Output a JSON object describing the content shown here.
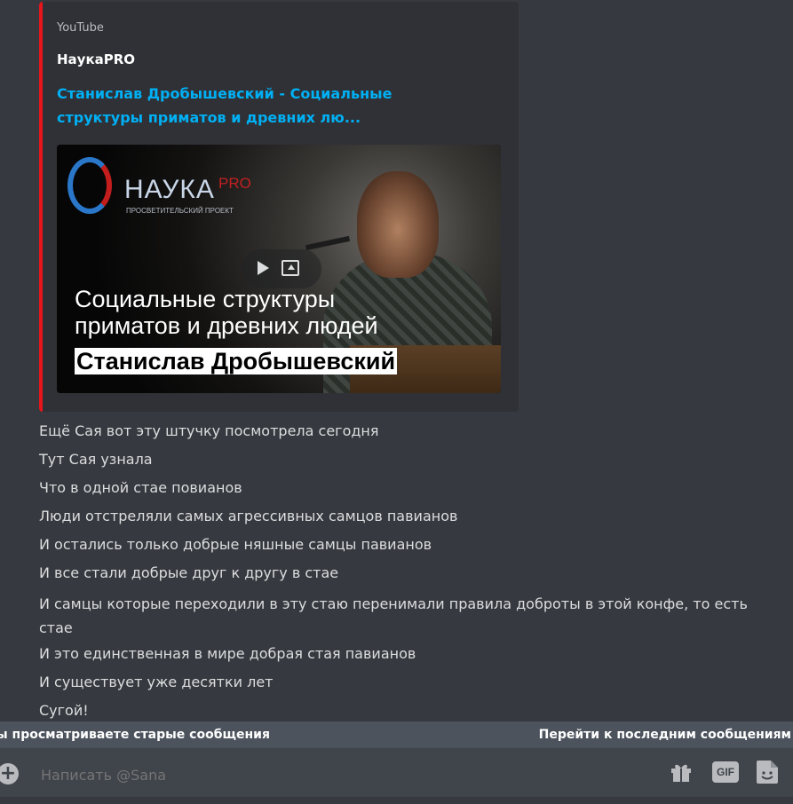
{
  "embed": {
    "provider": "YouTube",
    "author": "НаукаPRO",
    "title": "Станислав Дробышевский - Социальные структуры приматов и древних лю...",
    "accent_color": "#e5151b",
    "thumbnail": {
      "logo_text": "НАУКА",
      "logo_pro": "PRO",
      "logo_subtitle": "ПРОСВЕТИТЕЛЬСКИЙ ПРОЕКТ",
      "line1": "Социальные структуры",
      "line2": "приматов и древних людей",
      "name": "Станислав Дробышевский"
    }
  },
  "messages": [
    "Ещё Сая вот эту штучку посмотрела сегодня",
    "Тут Сая узнала",
    "Что в одной стае повианов",
    "Люди отстреляли самых агрессивных самцов павианов",
    "И остались только добрые няшные самцы павианов",
    "И все стали добрые друг к другу в стае",
    "И самцы которые переходили в эту стаю перенимали правила доброты в этой конфе, то есть стае",
    "И это единственная в мире добрая стая павианов",
    "И существует уже десятки лет",
    "Сугой!"
  ],
  "old_messages_bar": {
    "left_text": "ы просматриваете старые сообщения",
    "jump_text": "Перейти к последним сообщениям"
  },
  "composer": {
    "placeholder": "Написать @Sana",
    "gif_label": "GIF"
  }
}
